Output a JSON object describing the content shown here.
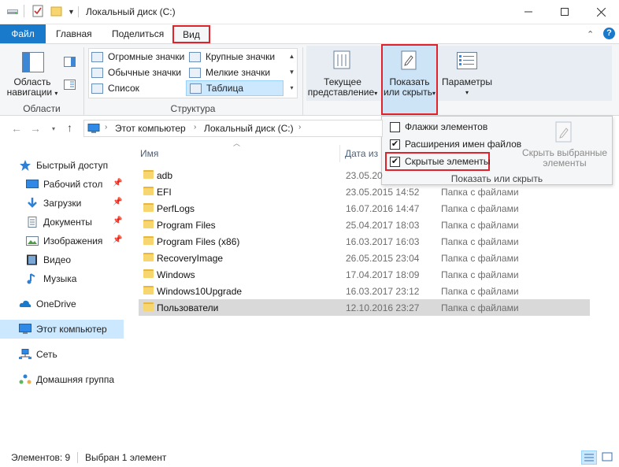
{
  "window": {
    "title": "Локальный диск (C:)",
    "controls": [
      "minimize-icon",
      "maximize-icon",
      "close-icon"
    ]
  },
  "ribbon_tabs": [
    {
      "label": "Файл",
      "active": false
    },
    {
      "label": "Главная",
      "active": false
    },
    {
      "label": "Поделиться",
      "active": false
    },
    {
      "label": "Вид",
      "active": true,
      "highlighted": true
    }
  ],
  "ribbon": {
    "panes_group": {
      "nav_pane_label": "Область навигации",
      "nav_pane_line1": "Область",
      "nav_pane_line2": "навигации",
      "group_label": "Области"
    },
    "layout_group": {
      "items": [
        "Огромные значки",
        "Крупные значки",
        "Обычные значки",
        "Мелкие значки",
        "Список",
        "Таблица"
      ],
      "selected": "Таблица",
      "group_label": "Структура"
    },
    "current_view": {
      "line1": "Текущее",
      "line2": "представление"
    },
    "show_hide": {
      "line1": "Показать",
      "line2": "или скрыть",
      "highlighted": true
    },
    "options": {
      "label": "Параметры"
    }
  },
  "show_hide_panel": {
    "checkboxes": [
      {
        "label": "Флажки элементов",
        "checked": false
      },
      {
        "label": "Расширения имен файлов",
        "checked": true
      },
      {
        "label": "Скрытые элементы",
        "checked": true,
        "highlighted": true
      }
    ],
    "hide_selected_line1": "Скрыть выбранные",
    "hide_selected_line2": "элементы",
    "group_label": "Показать или скрыть"
  },
  "address": {
    "segments": [
      "Этот компьютер",
      "Локальный диск (C:)"
    ]
  },
  "nav_pane": {
    "items": [
      {
        "label": "Быстрый доступ",
        "icon": "star-icon",
        "pinned": false
      },
      {
        "label": "Рабочий стол",
        "icon": "desktop-icon",
        "pinned": true
      },
      {
        "label": "Загрузки",
        "icon": "download-icon",
        "pinned": true
      },
      {
        "label": "Документы",
        "icon": "documents-icon",
        "pinned": true
      },
      {
        "label": "Изображения",
        "icon": "pictures-icon",
        "pinned": true
      },
      {
        "label": "Видео",
        "icon": "video-icon",
        "pinned": false
      },
      {
        "label": "Музыка",
        "icon": "music-icon",
        "pinned": false
      },
      {
        "label": "OneDrive",
        "icon": "cloud-icon",
        "pinned": false
      },
      {
        "label": "Этот компьютер",
        "icon": "computer-icon",
        "pinned": false,
        "selected": true
      },
      {
        "label": "Сеть",
        "icon": "network-icon",
        "pinned": false
      },
      {
        "label": "Домашняя группа",
        "icon": "homegroup-icon",
        "pinned": false
      }
    ]
  },
  "file_list": {
    "columns": [
      "Имя",
      "Дата из"
    ],
    "rows": [
      {
        "name": "adb",
        "date": "23.05.20",
        "type": ""
      },
      {
        "name": "EFI",
        "date": "23.05.2015 14:52",
        "type": "Папка с файлами"
      },
      {
        "name": "PerfLogs",
        "date": "16.07.2016 14:47",
        "type": "Папка с файлами"
      },
      {
        "name": "Program Files",
        "date": "25.04.2017 18:03",
        "type": "Папка с файлами"
      },
      {
        "name": "Program Files (x86)",
        "date": "16.03.2017 16:03",
        "type": "Папка с файлами"
      },
      {
        "name": "RecoveryImage",
        "date": "26.05.2015 23:04",
        "type": "Папка с файлами"
      },
      {
        "name": "Windows",
        "date": "17.04.2017 18:09",
        "type": "Папка с файлами"
      },
      {
        "name": "Windows10Upgrade",
        "date": "16.03.2017 23:12",
        "type": "Папка с файлами"
      },
      {
        "name": "Пользователи",
        "date": "12.10.2016 23:27",
        "type": "Папка с файлами",
        "selected": true
      }
    ]
  },
  "status": {
    "count": "Элементов: 9",
    "selection": "Выбран 1 элемент"
  },
  "colors": {
    "accent": "#1979ca",
    "highlight_red": "#e0232b",
    "selection": "#d9d9d9"
  }
}
